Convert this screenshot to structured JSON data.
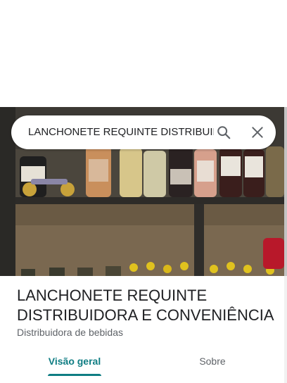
{
  "search": {
    "query": "LANCHONETE REQUINTE DISTRIBUIDORA E CONVENIÊNCIA"
  },
  "place": {
    "title": "LANCHONETE REQUINTE DISTRIBUIDORA E CONVENIÊNCIA",
    "category": "Distribuidora de bebidas"
  },
  "tabs": [
    {
      "label": "Visão geral",
      "active": true
    },
    {
      "label": "Sobre",
      "active": false
    }
  ],
  "colors": {
    "accent": "#0f7d83",
    "title": "#202124",
    "secondary": "#5f6368"
  },
  "icons": {
    "search": "search-icon",
    "close": "close-icon"
  }
}
